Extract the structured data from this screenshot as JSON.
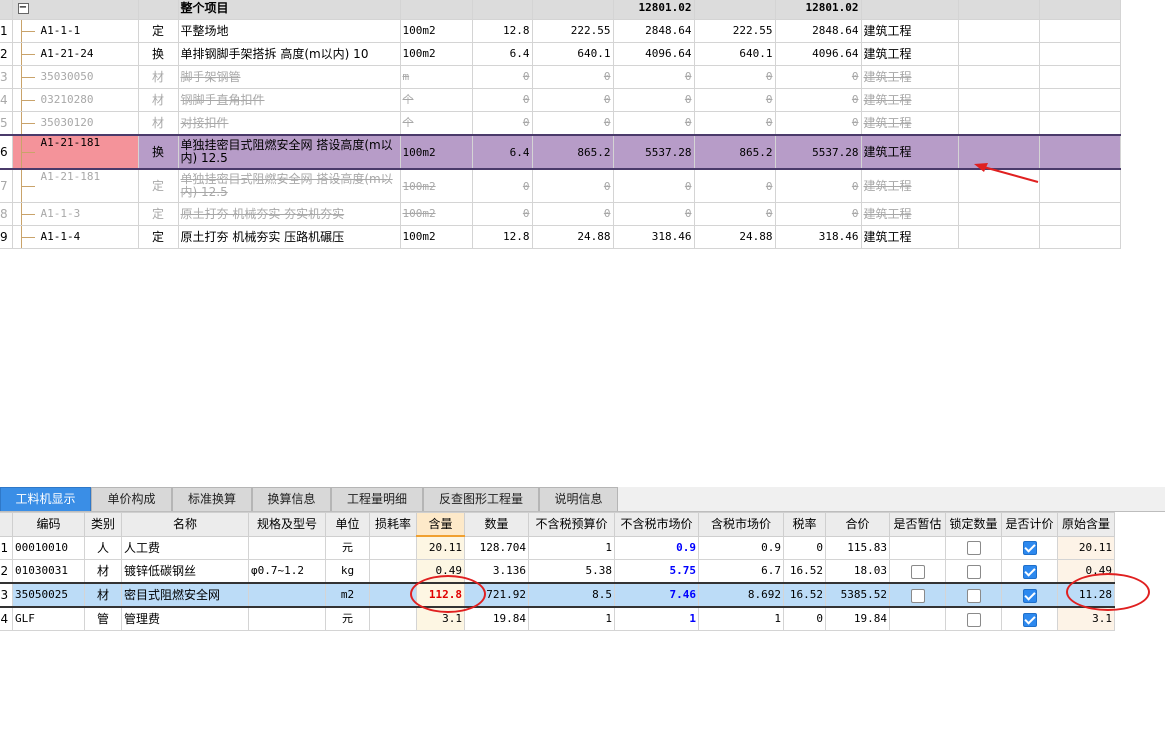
{
  "top_grid": {
    "header": {
      "name": "整个项目",
      "total1": "12801.02",
      "total2": "12801.02"
    },
    "rows": [
      {
        "n": "1",
        "code": "A1-1-1",
        "type": "定",
        "name": "平整场地",
        "unit": "100m2",
        "qty": "12.8",
        "p1": "222.55",
        "t1": "2848.64",
        "p2": "222.55",
        "t2": "2848.64",
        "cat": "建筑工程",
        "state": "norm"
      },
      {
        "n": "2",
        "code": "A1-21-24",
        "type": "换",
        "name": "单排钢脚手架搭拆 高度(m以内) 10",
        "unit": "100m2",
        "qty": "6.4",
        "p1": "640.1",
        "t1": "4096.64",
        "p2": "640.1",
        "t2": "4096.64",
        "cat": "建筑工程",
        "state": "norm"
      },
      {
        "n": "3",
        "code": "35030050",
        "type": "材",
        "name": "脚手架钢管",
        "unit": "m",
        "qty": "0",
        "p1": "0",
        "t1": "0",
        "p2": "0",
        "t2": "0",
        "cat": "建筑工程",
        "state": "del"
      },
      {
        "n": "4",
        "code": "03210280",
        "type": "材",
        "name": "钢脚手直角扣件",
        "unit": "个",
        "qty": "0",
        "p1": "0",
        "t1": "0",
        "p2": "0",
        "t2": "0",
        "cat": "建筑工程",
        "state": "del"
      },
      {
        "n": "5",
        "code": "35030120",
        "type": "材",
        "name": "对接扣件",
        "unit": "个",
        "qty": "0",
        "p1": "0",
        "t1": "0",
        "p2": "0",
        "t2": "0",
        "cat": "建筑工程",
        "state": "del"
      },
      {
        "n": "6",
        "code": "A1-21-181",
        "type": "换",
        "name": "单独挂密目式阻燃安全网 搭设高度(m以内) 12.5",
        "unit": "100m2",
        "qty": "6.4",
        "p1": "865.2",
        "t1": "5537.28",
        "p2": "865.2",
        "t2": "5537.28",
        "cat": "建筑工程",
        "state": "sel"
      },
      {
        "n": "7",
        "code": "A1-21-181",
        "type": "定",
        "name": "单独挂密目式阻燃安全网 搭设高度(m以内) 12.5",
        "unit": "100m2",
        "qty": "0",
        "p1": "0",
        "t1": "0",
        "p2": "0",
        "t2": "0",
        "cat": "建筑工程",
        "state": "del"
      },
      {
        "n": "8",
        "code": "A1-1-3",
        "type": "定",
        "name": "原土打夯 机械夯实 夯实机夯实",
        "unit": "100m2",
        "qty": "0",
        "p1": "0",
        "t1": "0",
        "p2": "0",
        "t2": "0",
        "cat": "建筑工程",
        "state": "del"
      },
      {
        "n": "9",
        "code": "A1-1-4",
        "type": "定",
        "name": "原土打夯 机械夯实 压路机碾压",
        "unit": "100m2",
        "qty": "12.8",
        "p1": "24.88",
        "t1": "318.46",
        "p2": "24.88",
        "t2": "318.46",
        "cat": "建筑工程",
        "state": "norm"
      }
    ]
  },
  "tabs": [
    {
      "label": "工料机显示",
      "active": true
    },
    {
      "label": "单价构成"
    },
    {
      "label": "标准换算"
    },
    {
      "label": "换算信息"
    },
    {
      "label": "工程量明细"
    },
    {
      "label": "反查图形工程量"
    },
    {
      "label": "说明信息"
    }
  ],
  "bottom_grid": {
    "columns": [
      "编码",
      "类别",
      "名称",
      "规格及型号",
      "单位",
      "损耗率",
      "含量",
      "数量",
      "不含税预算价",
      "不含税市场价",
      "含税市场价",
      "税率",
      "合价",
      "是否暂估",
      "锁定数量",
      "是否计价",
      "原始含量"
    ],
    "rows": [
      {
        "n": "1",
        "code": "00010010",
        "type": "人",
        "name": "人工费",
        "spec": "",
        "unit": "元",
        "loss": "",
        "content": "20.11",
        "qty": "128.704",
        "budget": "1",
        "market": "0.9",
        "taxmarket": "0.9",
        "rate": "0",
        "total": "115.83",
        "est": null,
        "lock": false,
        "priced": true,
        "orig": "20.11"
      },
      {
        "n": "2",
        "code": "01030031",
        "type": "材",
        "name": "镀锌低碳钢丝",
        "spec": "φ0.7~1.2",
        "unit": "kg",
        "loss": "",
        "content": "0.49",
        "qty": "3.136",
        "budget": "5.38",
        "market": "5.75",
        "taxmarket": "6.7",
        "rate": "16.52",
        "total": "18.03",
        "est": false,
        "lock": false,
        "priced": true,
        "orig": "0.49"
      },
      {
        "n": "3",
        "code": "35050025",
        "type": "材",
        "name": "密目式阻燃安全网",
        "spec": "",
        "unit": "m2",
        "loss": "",
        "content": "112.8",
        "qty": "721.92",
        "budget": "8.5",
        "market": "7.46",
        "taxmarket": "8.692",
        "rate": "16.52",
        "total": "5385.52",
        "est": false,
        "lock": false,
        "priced": true,
        "orig": "11.28"
      },
      {
        "n": "4",
        "code": "GLF",
        "type": "管",
        "name": "管理费",
        "spec": "",
        "unit": "元",
        "loss": "",
        "content": "3.1",
        "qty": "19.84",
        "budget": "1",
        "market": "1",
        "taxmarket": "1",
        "rate": "0",
        "total": "19.84",
        "est": null,
        "lock": false,
        "priced": true,
        "orig": "3.1"
      }
    ]
  },
  "colors": {
    "selected_top": "#b79cc8",
    "selected_code": "#f4939a",
    "selected_bottom": "#bcdcf7",
    "tab_active": "#3a8ee6",
    "annotation": "#e02020"
  },
  "icons": {
    "expand": "minus-box-icon",
    "arrow": "red-arrow-icon"
  }
}
